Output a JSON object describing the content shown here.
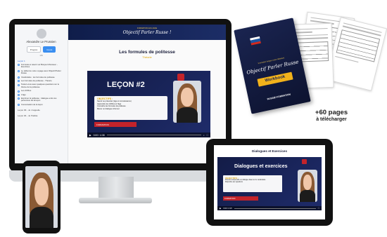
{
  "desktop": {
    "sidebar": {
      "student_name": "Alexandre Le Prussien",
      "tabs": [
        "Progrès",
        "Cours"
      ],
      "sub_label": "1/8",
      "section_label": "Leçon 1",
      "items": [
        "Formules à retenir sur Bonjour Monsieur - Exercices",
        "Le début de votre voyage avec Objectif Parler Russe",
        "Vocabulaire : les formules de politesse",
        "Les formules de politesse - Théorie",
        "Testez-vous avec quelques questions sur le thème de la politesse",
        "Les chiffres",
        "L'âge",
        "Exprimer la politesse : dialogue entre les personnes de la leçon",
        "Conversation de la leçon"
      ],
      "lessons": [
        "Leçon #3 - Je m'appelle",
        "Leçon #4 - Je l'habite"
      ]
    },
    "banner": {
      "subtitle": "FORMATION EN LIGNE",
      "title": "Objectif Parler Russe !"
    },
    "lesson_title": "Les formules de politesse",
    "lesson_category": "Théorie",
    "video": {
      "heading": "LEÇON #2",
      "objectives_title": "OBJECTIFS :",
      "objectives": [
        "Savoir se présenter (âge et connaissance)",
        "Apprendre les chiffres et l'âge",
        "Connaître les formules de politesse",
        "Mener un dialogue informel"
      ],
      "brand": "FORMATION",
      "time": "0:00 / 4:38",
      "play_icon": "play-icon",
      "fullscreen_icon": "fullscreen-icon"
    }
  },
  "workbook": {
    "subtitle": "Formation langue russe débutant",
    "title": "Objectif Parler Russe",
    "badge": "Workbook",
    "brand": "RUSSIE-FORMATION",
    "flag_colors": [
      "#ffffff",
      "#1c57a5",
      "#d52b1e"
    ]
  },
  "pages_caption": {
    "count": "+60 pages",
    "download": "à télécharger"
  },
  "tablet": {
    "title": "Dialogues et Exercices",
    "video": {
      "heading": "Dialogues et exercices",
      "objectives_title": "OBJECTIFS :",
      "objectives": [
        "Pouvoir comprendre un dialogue basé sur le vocabulaire",
        "Répondre aux questions"
      ],
      "brand": "FORMATION",
      "time": "0:00 / 2:15"
    }
  },
  "colors": {
    "navy": "#131c47",
    "gold": "#f2b21b",
    "red": "#c3232a",
    "accent_blue": "#3a8ef0"
  }
}
